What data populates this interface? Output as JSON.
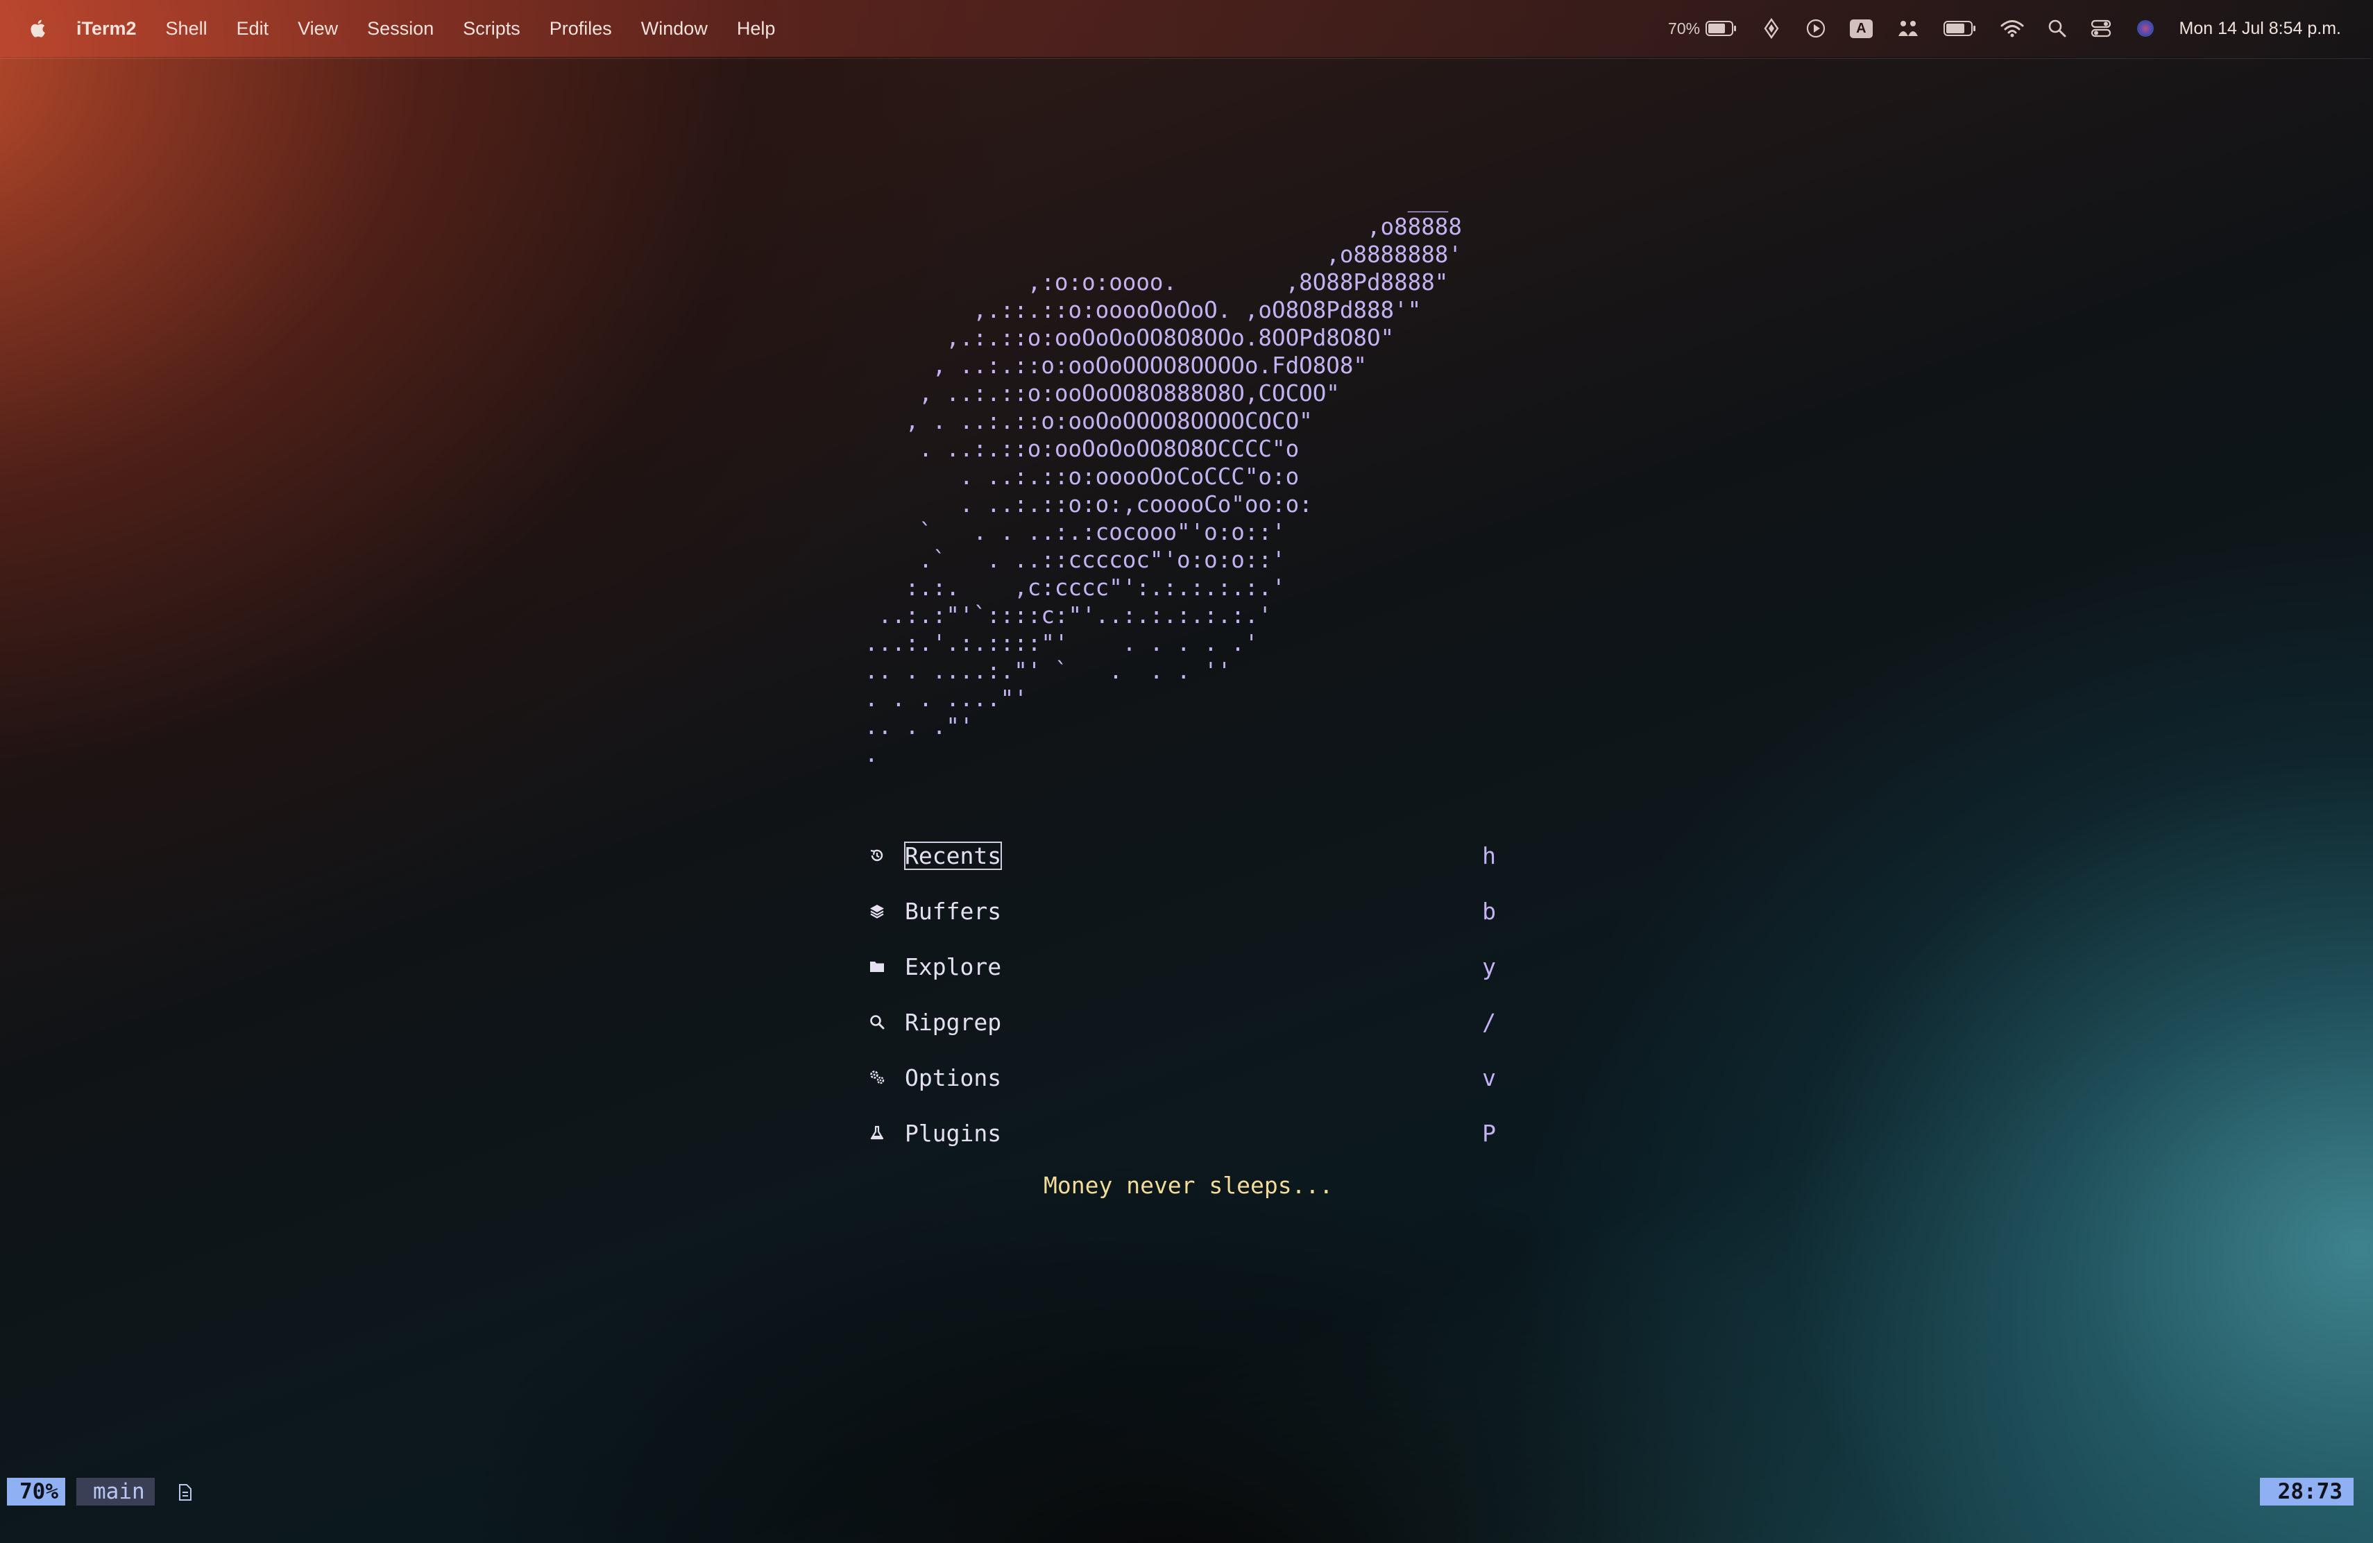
{
  "menubar": {
    "app_name": "iTerm2",
    "menus": [
      "Shell",
      "Edit",
      "View",
      "Session",
      "Scripts",
      "Profiles",
      "Window",
      "Help"
    ],
    "battery_percent": "70%",
    "input_source": "A",
    "datetime": "Mon 14 Jul  8:54 p.m.",
    "status_icons": [
      "battery-icon",
      "location-icon",
      "play-icon",
      "input-source-icon",
      "people-icon",
      "battery-charging-icon",
      "wifi-icon",
      "spotlight-search-icon",
      "control-center-icon",
      "siri-icon"
    ]
  },
  "dashboard": {
    "ascii_art": "                                        ___\n                                     ,o88888\n                                  ,o8888888'\n            ,:o:o:oooo.        ,8O88Pd8888\"\n        ,.::.::o:ooooOoOoO. ,oO8O8Pd888'\"\n      ,.:.::o:ooOoOoOO8O8OOo.8OOPd8O8O\"\n     , ..:.::o:ooOoOOOO8OOOOo.FdO8O8\"\n    , ..:.::o:ooOoOO8O888O8O,COCOO\"\n   , . ..:.::o:ooOoOOOO8OOOOCOCO\"\n    . ..:.::o:ooOoOoOO8O8OCCCC\"o\n       . ..:.::o:ooooOoCoCCC\"o:o\n       . ..:.::o:o:,cooooCo\"oo:o:\n    `   . . ..:.:cocooo\"'o:o::'\n    .`   . ..::ccccoc\"'o:o:o::'\n   :.:.    ,c:cccc\"':.:.:.:.:.'\n ..:.:\"'`::::c:\"'..:.:.:.:.:.'\n...:.'.:.::::\"'    . . . . .'\n.. . ....:.\"' `   .  . . ''\n. . . ....\"'\n.. . .\"'\n.",
    "menu": [
      {
        "icon": "history-icon",
        "label": "Recents",
        "key": "h"
      },
      {
        "icon": "layers-icon",
        "label": "Buffers",
        "key": "b"
      },
      {
        "icon": "folder-icon",
        "label": "Explore",
        "key": "y"
      },
      {
        "icon": "search-icon",
        "label": "Ripgrep",
        "key": "/"
      },
      {
        "icon": "gears-icon",
        "label": "Options",
        "key": "v"
      },
      {
        "icon": "flask-icon",
        "label": "Plugins",
        "key": "P"
      }
    ],
    "footer": "Money never sleeps..."
  },
  "statusline": {
    "percent": "70%",
    "branch": "main",
    "position": "28:73"
  },
  "colors": {
    "accent_lavender": "#c4b3f3",
    "footer_yellow": "#f3dc98",
    "statusline_blue": "#8fb0f2",
    "statusline_gray": "#3a3f56"
  }
}
